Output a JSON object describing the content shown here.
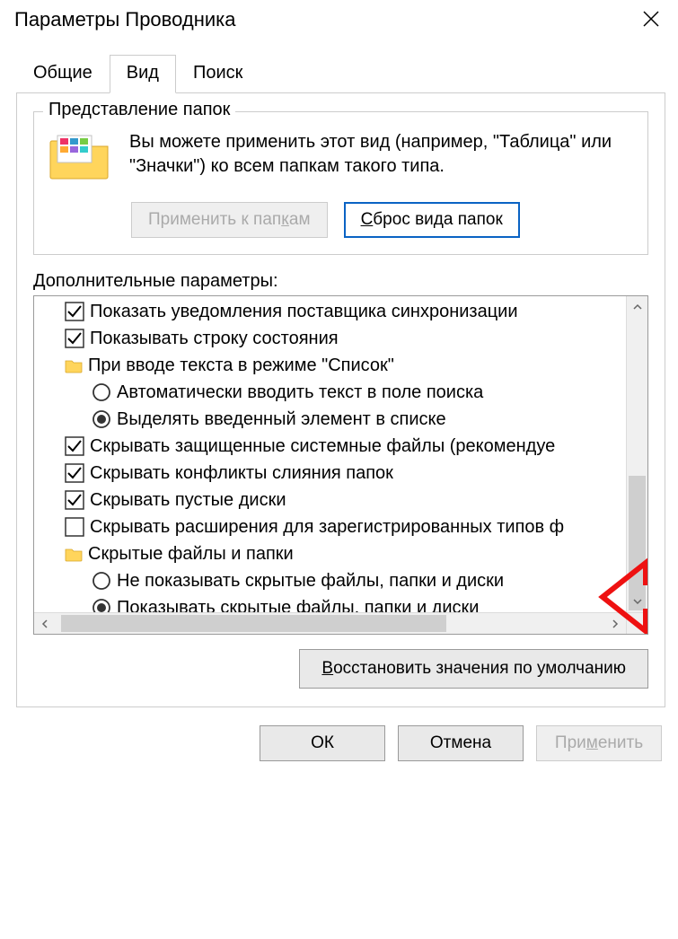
{
  "title": "Параметры Проводника",
  "tabs": {
    "general": "Общие",
    "view": "Вид",
    "search": "Поиск"
  },
  "folder_views": {
    "legend": "Представление папок",
    "desc": "Вы можете применить этот вид (например, \"Таблица\" или \"Значки\") ко всем папкам такого типа.",
    "apply_pre": "Применить к пап",
    "apply_u": "к",
    "apply_post": "ам",
    "reset_u": "С",
    "reset_post": "брос вида папок"
  },
  "advanced_label": "Дополнительные параметры:",
  "items": [
    {
      "kind": "check",
      "checked": true,
      "label": "Показать уведомления поставщика синхронизации"
    },
    {
      "kind": "check",
      "checked": true,
      "label": "Показывать строку состояния"
    },
    {
      "kind": "folder",
      "label": "При вводе текста в режиме \"Список\""
    },
    {
      "kind": "radio",
      "checked": false,
      "indent": true,
      "label": "Автоматически вводить текст в поле поиска"
    },
    {
      "kind": "radio",
      "checked": true,
      "indent": true,
      "label": "Выделять введенный элемент в списке"
    },
    {
      "kind": "check",
      "checked": true,
      "label": "Скрывать защищенные системные файлы (рекомендуе"
    },
    {
      "kind": "check",
      "checked": true,
      "label": "Скрывать конфликты слияния папок"
    },
    {
      "kind": "check",
      "checked": true,
      "label": "Скрывать пустые диски"
    },
    {
      "kind": "check",
      "checked": false,
      "label": "Скрывать расширения для зарегистрированных типов ф"
    },
    {
      "kind": "folder",
      "label": "Скрытые файлы и папки"
    },
    {
      "kind": "radio",
      "checked": false,
      "indent": true,
      "label": "Не показывать скрытые файлы, папки и диски"
    },
    {
      "kind": "radio",
      "checked": true,
      "indent": true,
      "label": "Показывать скрытые файлы, папки и диски"
    }
  ],
  "restore_pre": "В",
  "restore_post": "осстановить значения по умолчанию",
  "footer": {
    "ok": "ОК",
    "cancel": "Отмена",
    "apply_pre": "При",
    "apply_u": "м",
    "apply_post": "енить"
  }
}
